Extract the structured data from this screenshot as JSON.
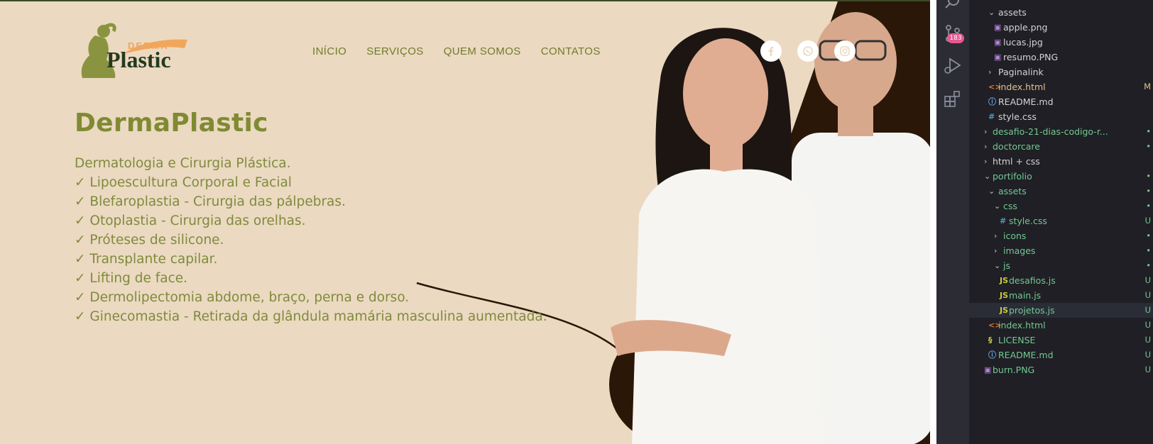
{
  "site": {
    "logo": {
      "small": "DERMA",
      "big": "Plastic"
    },
    "nav": [
      "INÍCIO",
      "SERVIÇOS",
      "QUEM SOMOS",
      "CONTATOS"
    ],
    "title": "DermaPlastic",
    "services": [
      "Dermatologia e Cirurgia Plástica.",
      "✓ Lipoescultura Corporal e Facial",
      "✓ Blefaroplastia - Cirurgia das pálpebras.",
      "✓ Otoplastia - Cirurgia das orelhas.",
      "✓ Próteses de silicone.",
      "✓ Transplante capilar.",
      "✓ Lifting de face.",
      "✓ Dermolipectomia abdome, braço, perna e dorso.",
      "✓ Ginecomastia - Retirada da glândula mamária masculina aumentada."
    ],
    "social_icons": [
      "facebook-icon",
      "whatsapp-icon",
      "instagram-icon"
    ],
    "colors": {
      "background": "#ecd9c1",
      "accent": "#7f8b33",
      "dark": "#2a1708"
    }
  },
  "activity_bar": {
    "icons": [
      "search-icon",
      "source-control-icon",
      "run-debug-icon",
      "extensions-icon"
    ],
    "source_control_badge": "183"
  },
  "explorer": {
    "rows": [
      {
        "label": "assets",
        "kind": "folder-open",
        "indent": 1,
        "color": "white",
        "status": ""
      },
      {
        "label": "apple.png",
        "kind": "image",
        "indent": 2,
        "color": "white",
        "status": ""
      },
      {
        "label": "lucas.jpg",
        "kind": "image",
        "indent": 2,
        "color": "white",
        "status": ""
      },
      {
        "label": "resumo.PNG",
        "kind": "image",
        "indent": 2,
        "color": "white",
        "status": ""
      },
      {
        "label": "Paginalink",
        "kind": "folder",
        "indent": 1,
        "color": "white",
        "status": ""
      },
      {
        "label": "index.html",
        "kind": "html",
        "indent": 1,
        "color": "yellow",
        "status": "M"
      },
      {
        "label": "README.md",
        "kind": "info",
        "indent": 1,
        "color": "white",
        "status": ""
      },
      {
        "label": "style.css",
        "kind": "css",
        "indent": 1,
        "color": "white",
        "status": ""
      },
      {
        "label": "desafio-21-dias-codigo-r...",
        "kind": "folder",
        "indent": 0,
        "color": "green",
        "status": "•"
      },
      {
        "label": "doctorcare",
        "kind": "folder",
        "indent": 0,
        "color": "green",
        "status": "•"
      },
      {
        "label": "html + css",
        "kind": "folder",
        "indent": 0,
        "color": "white",
        "status": ""
      },
      {
        "label": "portifolio",
        "kind": "folder-open",
        "indent": 0,
        "color": "green",
        "status": "•"
      },
      {
        "label": "assets",
        "kind": "folder-open",
        "indent": 1,
        "color": "green",
        "status": "•"
      },
      {
        "label": "css",
        "kind": "folder-open",
        "indent": 2,
        "color": "green",
        "status": "•"
      },
      {
        "label": "style.css",
        "kind": "css",
        "indent": 3,
        "color": "green",
        "status": "U"
      },
      {
        "label": "icons",
        "kind": "folder",
        "indent": 2,
        "color": "green",
        "status": "•"
      },
      {
        "label": "images",
        "kind": "folder",
        "indent": 2,
        "color": "green",
        "status": "•"
      },
      {
        "label": "js",
        "kind": "folder-open",
        "indent": 2,
        "color": "green",
        "status": "•"
      },
      {
        "label": "desafios.js",
        "kind": "js",
        "indent": 3,
        "color": "green",
        "status": "U"
      },
      {
        "label": "main.js",
        "kind": "js",
        "indent": 3,
        "color": "green",
        "status": "U"
      },
      {
        "label": "projetos.js",
        "kind": "js",
        "indent": 3,
        "color": "green",
        "status": "U",
        "selected": true
      },
      {
        "label": "index.html",
        "kind": "html",
        "indent": 1,
        "color": "green",
        "status": "U"
      },
      {
        "label": "LICENSE",
        "kind": "license",
        "indent": 1,
        "color": "green",
        "status": "U"
      },
      {
        "label": "README.md",
        "kind": "info",
        "indent": 1,
        "color": "green",
        "status": "U"
      },
      {
        "label": "burn.PNG",
        "kind": "image",
        "indent": 0,
        "color": "green",
        "status": "U"
      }
    ]
  }
}
